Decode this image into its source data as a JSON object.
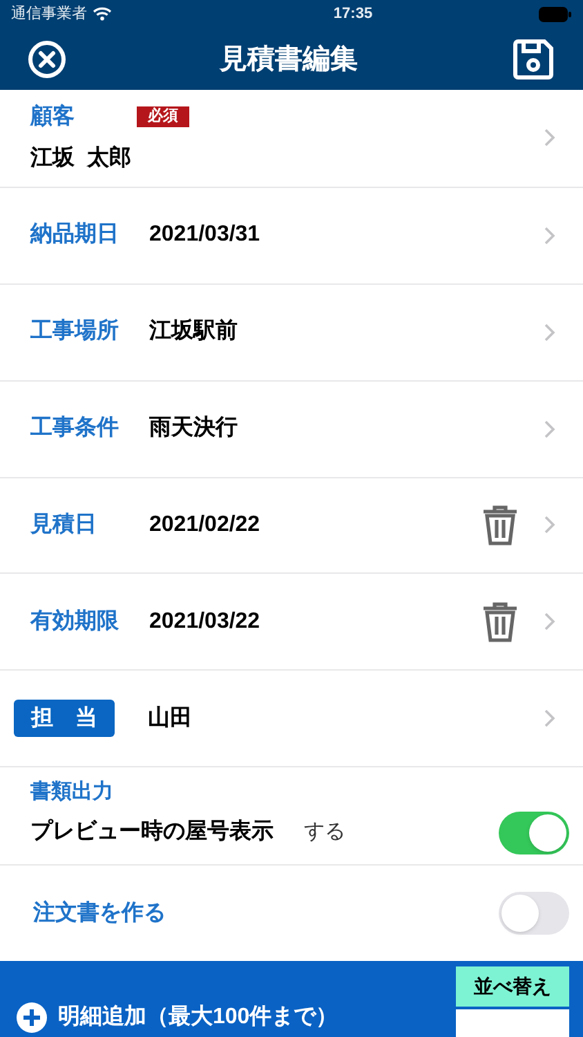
{
  "status_bar": {
    "carrier": "通信事業者",
    "time": "17:35"
  },
  "nav": {
    "title": "見積書編集"
  },
  "rows": [
    {
      "kind": "stacked",
      "label": "顧客",
      "badge": "必須",
      "value": "江坂  太郎",
      "chevron": true
    },
    {
      "kind": "inline",
      "label": "納品期日",
      "value": "2021/03/31",
      "chevron": true,
      "deletable": false
    },
    {
      "kind": "inline",
      "label": "工事場所",
      "value": "江坂駅前",
      "chevron": true,
      "deletable": false
    },
    {
      "kind": "inline",
      "label": "工事条件",
      "value": "雨天決行",
      "chevron": true,
      "deletable": false
    },
    {
      "kind": "inline",
      "label": "見積日",
      "value": "2021/02/22",
      "chevron": true,
      "deletable": true
    },
    {
      "kind": "inline",
      "label": "有効期限",
      "value": "2021/03/22",
      "chevron": true,
      "deletable": true
    },
    {
      "kind": "tagged",
      "label": "担　当",
      "value": "山田",
      "chevron": true
    },
    {
      "kind": "switch_group",
      "label": "書類出力",
      "option": "プレビュー時の屋号表示",
      "value": "する",
      "on": true
    },
    {
      "kind": "switch",
      "label": "注文書を作る",
      "on": false
    }
  ],
  "bottom_bar": {
    "add_label": "明細追加（最大100件まで）",
    "sort_label": "並べ替え"
  }
}
